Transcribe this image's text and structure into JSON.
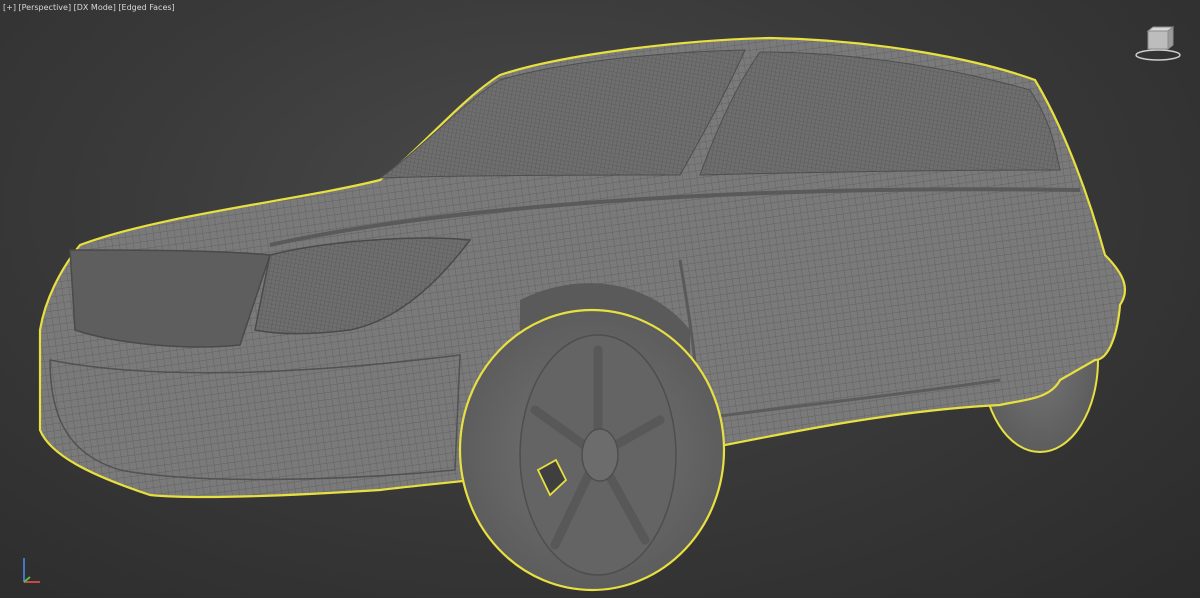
{
  "viewport": {
    "labels": [
      {
        "text": "[+]",
        "name": "viewport-menu-label"
      },
      {
        "text": "[Perspective]",
        "name": "view-mode-label"
      },
      {
        "text": "[DX Mode]",
        "name": "render-mode-label"
      },
      {
        "text": "[Edged Faces]",
        "name": "shading-mode-label"
      }
    ]
  },
  "colors": {
    "background": "#3a3a3a",
    "mesh": "#777777",
    "mesh_lines": "#555555",
    "selection_outline": "#e8e040",
    "label_text": "#d8d8d8"
  },
  "icons": {
    "viewcube": "viewcube-icon",
    "axis": "axis-tripod-icon"
  }
}
